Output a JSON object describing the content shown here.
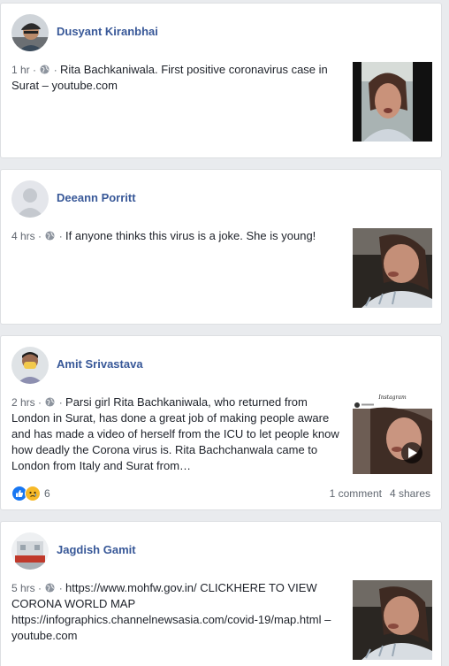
{
  "posts": [
    {
      "author": "Dusyant Kiranbhai",
      "time": "1 hr",
      "text": "Rita Bachkaniwala. First positive coronavirus case in Surat – youtube.com",
      "thumbnail": "video-thumbnail",
      "avatar": "avatar-man-cap"
    },
    {
      "author": "Deeann Porritt",
      "time": "4 hrs",
      "text": "If anyone thinks this virus is a joke. She is young!",
      "thumbnail": "video-thumbnail",
      "avatar": "avatar-default"
    },
    {
      "author": "Amit Srivastava",
      "time": "2 hrs",
      "text": "Parsi girl Rita Bachkaniwala, who returned from London in Surat, has done a great job of making people aware and has made a video of herself from the ICU to let people know how deadly the Corona virus is. Rita Bachchanwala came to London from Italy and Surat from…",
      "thumbnail": "instagram-video-thumbnail",
      "thumb_caption": "Instagram",
      "avatar": "avatar-man-mask",
      "reactions": {
        "count": "6",
        "icons": [
          "like-icon",
          "sad-icon"
        ]
      },
      "comments": "1 comment",
      "shares": "4 shares"
    },
    {
      "author": "Jagdish Gamit",
      "time": "5 hrs",
      "text": "https://www.mohfw.gov.in/ CLICKHERE TO VIEW CORONA WORLD MAP https://infographics.channelnewsasia.com/covid-19/map.html – youtube.com",
      "thumbnail": "video-thumbnail",
      "avatar": "avatar-building"
    }
  ],
  "separator": " · ",
  "colors": {
    "author_link": "#385898",
    "body_text": "#1d2129",
    "meta": "#616770",
    "background": "#e9ebee",
    "like_blue": "#1877f2",
    "sad_yellow": "#f7b928"
  }
}
